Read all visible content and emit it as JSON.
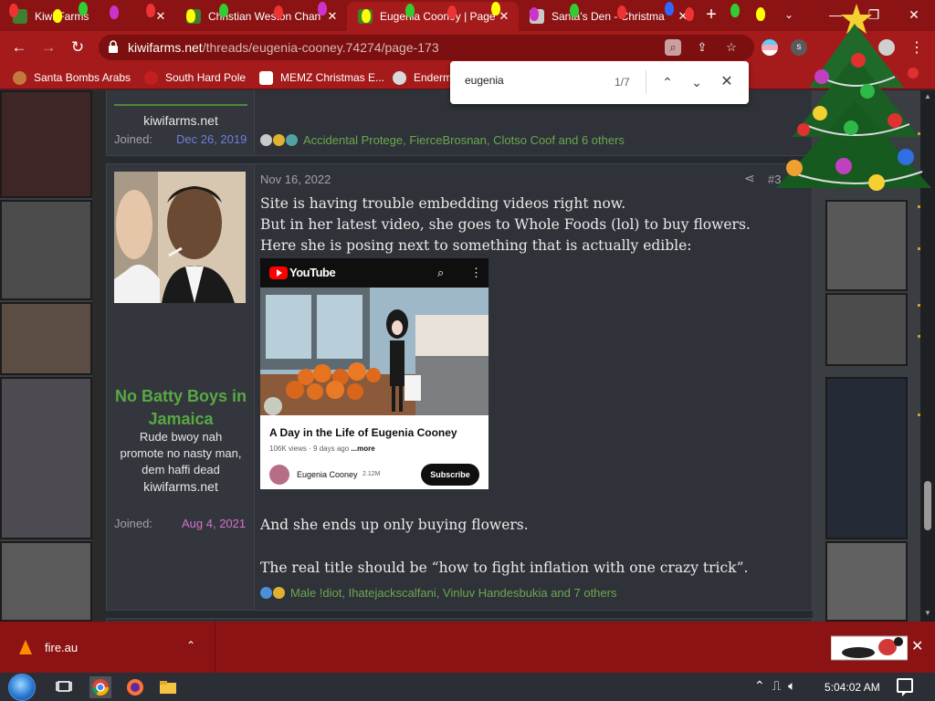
{
  "browser": {
    "tabs": [
      {
        "title": "Kiwi Farms",
        "active": false
      },
      {
        "title": "Christian Weston Chan",
        "active": false
      },
      {
        "title": "Eugenia Cooney | Page",
        "active": true
      },
      {
        "title": "Santa's Den - Christma",
        "active": false
      }
    ],
    "url": {
      "host": "kiwifarms.net",
      "path": "/threads/eugenia-cooney.74274/page-173"
    },
    "bookmarks": [
      "Santa Bombs Arabs",
      "South Hard Pole",
      "MEMZ Christmas E...",
      "Enderm"
    ],
    "window_controls": {
      "minimize": "—",
      "maximize": "❐",
      "close": "✕"
    }
  },
  "find_bar": {
    "query": "eugenia",
    "count": "1/7"
  },
  "previous_post": {
    "username_partial": " ",
    "signature": "kiwifarms.net",
    "joined_label": "Joined:",
    "joined_date": "Dec 26, 2019",
    "reactions": "Accidental Protege, FierceBrosnan, Clotso Coof and 6 others"
  },
  "post": {
    "username": "No Batty Boys in Jamaica",
    "user_title_lines": [
      "Rude bwoy nah",
      "promote no nasty man,",
      "dem haffi dead",
      "kiwifarms.net"
    ],
    "joined_label": "Joined:",
    "joined_date": "Aug 4, 2021",
    "date": "Nov 16, 2022",
    "post_number": "#3",
    "body": [
      "Site is having trouble embedding videos right now.",
      "But in her latest video, she goes to Whole Foods (lol) to buy flowers.",
      "Here she is posing next to something that is actually edible:",
      "And she ends up only buying flowers.",
      "The real title should be “how to fight inflation with one crazy trick”."
    ],
    "reactions": "Male !diot, Ihatejackscalfani, Vinluv Handesbukia and 7 others"
  },
  "youtube_embed": {
    "brand": "YouTube",
    "title": "A Day in the Life of Eugenia Cooney",
    "views": "106K views",
    "age": "· 9 days ago",
    "more": "...more",
    "channel": "Eugenia Cooney",
    "subscribers": "2.12M",
    "subscribe_label": "Subscribe"
  },
  "downloads": {
    "filename": "fire.au"
  },
  "taskbar": {
    "clock": "5:04:02 AM"
  },
  "colors": {
    "accent_red": "#a51b1b",
    "dark_red": "#8c1313",
    "username_green": "#58a844",
    "reaction_green": "#6aa84f",
    "date_blue": "#6f7ee0",
    "date_pink": "#d86fd0"
  }
}
